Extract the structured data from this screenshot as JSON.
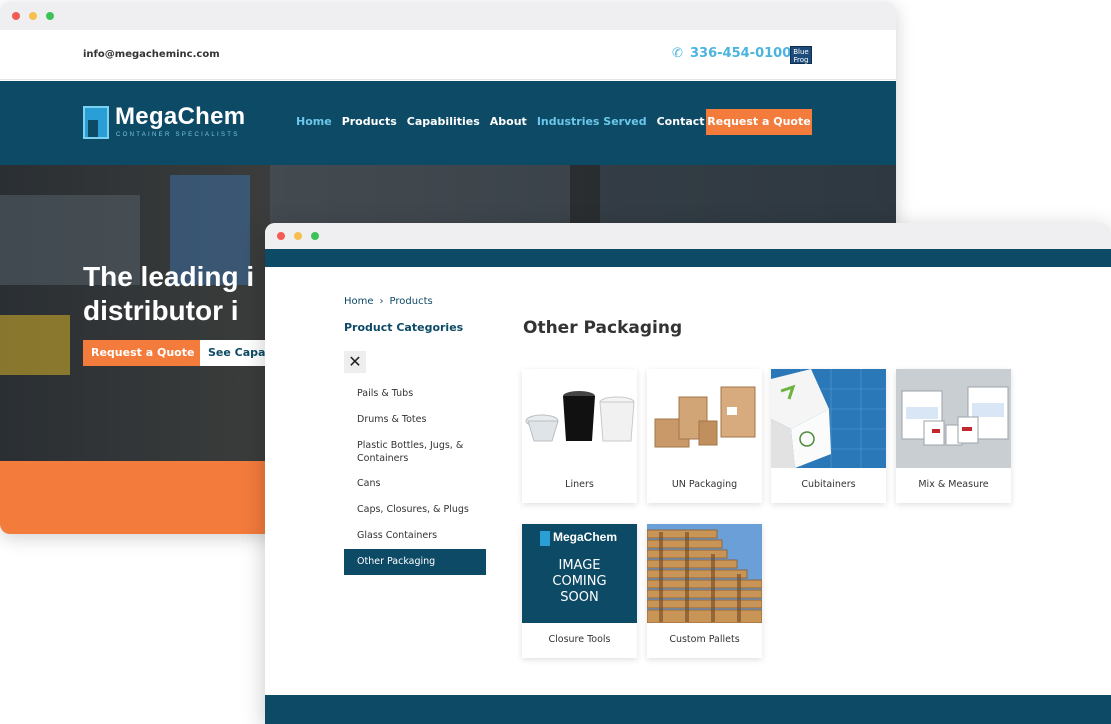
{
  "back_window": {
    "topbar": {
      "email": "info@megacheminc.com",
      "phone": "336-454-0100",
      "badge": "Blue Frog"
    },
    "logo": {
      "name": "MegaChem",
      "tagline": "CONTAINER SPECIALISTS"
    },
    "nav": [
      {
        "label": "Home",
        "active": true
      },
      {
        "label": "Products",
        "active": false
      },
      {
        "label": "Capabilities",
        "active": false
      },
      {
        "label": "About",
        "active": false
      },
      {
        "label": "Industries Served",
        "active": true
      },
      {
        "label": "Contact",
        "active": false
      }
    ],
    "quote_button": "Request a Quote",
    "hero": {
      "title": "The leading i\ndistributor i",
      "primary_button": "Request a Quote",
      "secondary_button": "See Capab"
    }
  },
  "front_window": {
    "breadcrumb": {
      "home": "Home",
      "separator": "›",
      "current": "Products"
    },
    "sidebar": {
      "title": "Product Categories",
      "close_symbol": "✕",
      "items": [
        {
          "label": "Pails & Tubs",
          "active": false
        },
        {
          "label": "Drums & Totes",
          "active": false
        },
        {
          "label": "Plastic Bottles, Jugs, & Containers",
          "active": false
        },
        {
          "label": "Cans",
          "active": false
        },
        {
          "label": "Caps, Closures, & Plugs",
          "active": false
        },
        {
          "label": "Glass Containers",
          "active": false
        },
        {
          "label": "Other Packaging",
          "active": true
        }
      ]
    },
    "page_title": "Other Packaging",
    "products": [
      {
        "label": "Liners"
      },
      {
        "label": "UN Packaging"
      },
      {
        "label": "Cubitainers"
      },
      {
        "label": "Mix & Measure"
      },
      {
        "label": "Closure Tools",
        "placeholder_logo": "MegaChem",
        "placeholder_text": "IMAGE\nCOMING\nSOON"
      },
      {
        "label": "Custom Pallets"
      }
    ]
  },
  "colors": {
    "navy": "#0d4a66",
    "orange": "#f37b3c",
    "light_blue": "#4bb4de"
  }
}
